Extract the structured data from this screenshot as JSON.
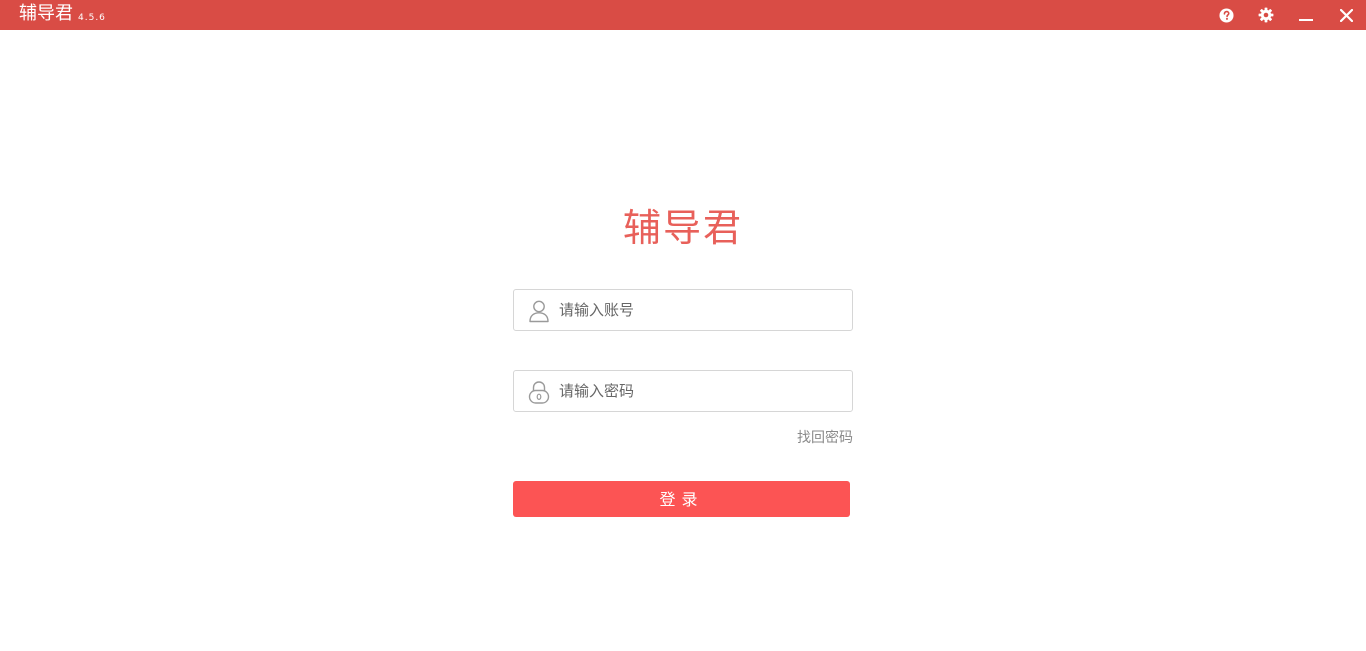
{
  "titlebar": {
    "app_name": "辅导君",
    "version": "4.5.6",
    "buttons": {
      "help_icon": "help-icon",
      "settings_icon": "gear-icon",
      "minimize_icon": "minimize-icon",
      "close_icon": "close-icon"
    },
    "background_color": "#d94c45"
  },
  "login": {
    "logo_text": "辅导君",
    "logo_color": "#e8605a",
    "account_placeholder": "请输入账号",
    "password_placeholder": "请输入密码",
    "forgot_password": "找回密码",
    "login_button": "登录",
    "login_button_color": "#fc5454",
    "account_icon": "user-icon",
    "password_icon": "lock-icon"
  }
}
